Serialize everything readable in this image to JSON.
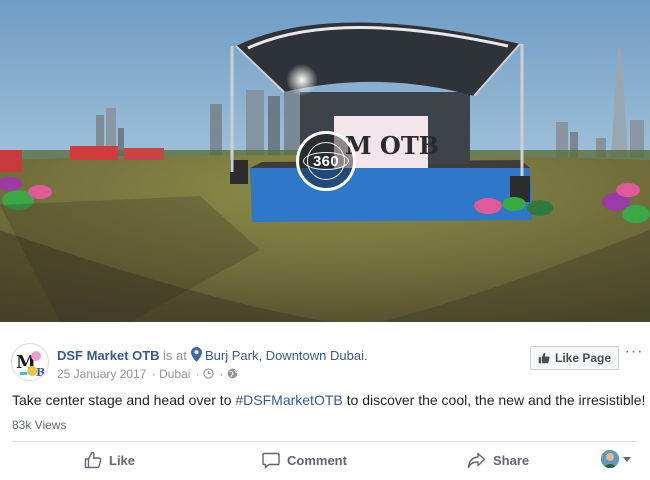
{
  "media": {
    "badge_label": "360",
    "stage_sign": "M OTB"
  },
  "post": {
    "page_name": "DSF Market OTB",
    "is_at": "is at",
    "location": "Burj Park, Downtown Dubai.",
    "date": "25 January 2017",
    "place": "Dubai",
    "separator": "·",
    "text_before": "Take center stage and head over to ",
    "hashtag": "#DSFMarketOTB",
    "text_after": " to discover the cool, the new and the irresistible!",
    "views": "83k Views",
    "like_page_label": "Like Page",
    "more_label": "···"
  },
  "actions": {
    "like": "Like",
    "comment": "Comment",
    "share": "Share"
  },
  "colors": {
    "link": "#365899",
    "muted": "#90949c",
    "heart": "#f25268"
  },
  "icons": {
    "location": "map-pin-icon",
    "clock": "clock-icon",
    "globe": "globe-icon",
    "thumb": "thumbs-up-icon",
    "comment": "comment-icon",
    "share": "share-arrow-icon",
    "heart": "heart-icon"
  }
}
